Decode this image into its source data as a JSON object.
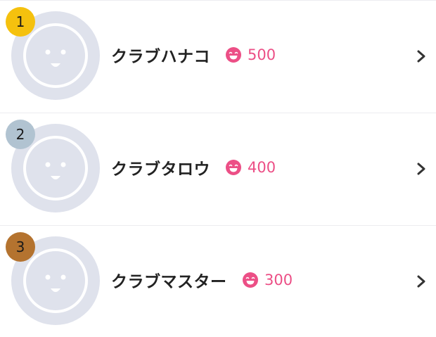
{
  "ranking": {
    "items": [
      {
        "rank": "1",
        "name": "クラブハナコ",
        "points": "500",
        "badge_color": "#f5c10e",
        "icon": "smile-icon"
      },
      {
        "rank": "2",
        "name": "クラブタロウ",
        "points": "400",
        "badge_color": "#b1c3d1",
        "icon": "smile-icon"
      },
      {
        "rank": "3",
        "name": "クラブマスター",
        "points": "300",
        "badge_color": "#b4732f",
        "icon": "smile-icon"
      }
    ]
  },
  "colors": {
    "points": "#ec4f86",
    "avatar_bg": "#dfe2ec",
    "text": "#222222",
    "divider": "#ececf0"
  }
}
